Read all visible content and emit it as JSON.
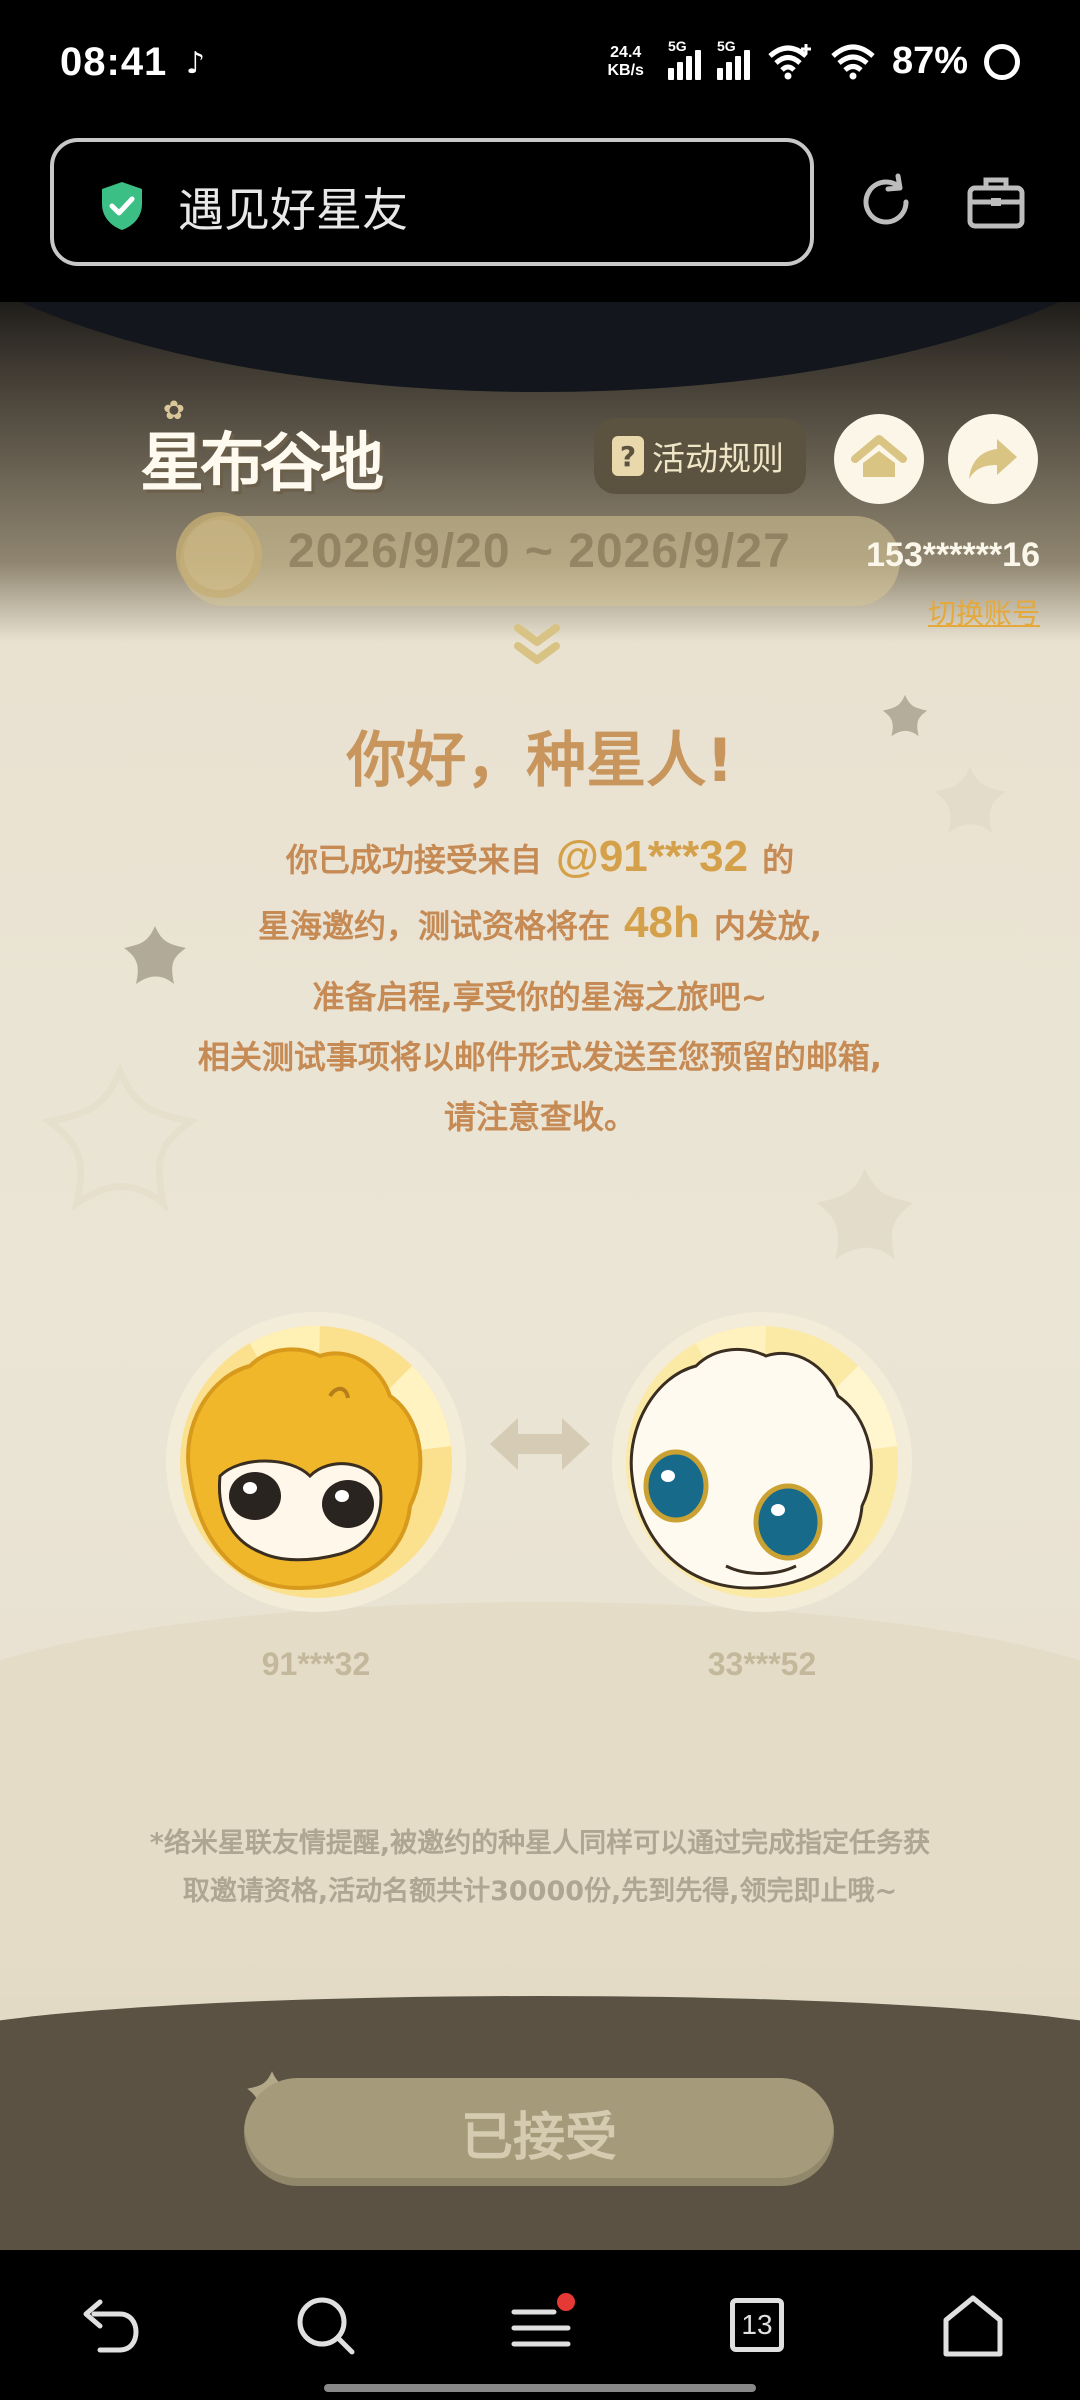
{
  "status_bar": {
    "time": "08:41",
    "notification_icon": "tiktok-icon",
    "net_speed_value": "24.4",
    "net_speed_unit": "KB/s",
    "sim1": "5G",
    "sim2": "5G",
    "battery": "87%"
  },
  "browser": {
    "url_title": "遇见好星友",
    "secure_icon": "shield-check-icon",
    "refresh_icon": "refresh-icon",
    "toolbox_icon": "briefcase-icon"
  },
  "page": {
    "logo": "星布谷地",
    "rules_label": "活动规则",
    "date_range": "2026/9/20 ~ 2026/9/27",
    "account": "153******16",
    "switch_account": "切换账号",
    "greeting": "你好，种星人!",
    "line1_pre": "你已成功接受来自",
    "inviter_handle": "@91***32",
    "line1_post": "的",
    "line2_pre": "星海邀约，测试资格将在",
    "hours": "48h",
    "line2_post": "内发放,",
    "line3": "准备启程,享受你的星海之旅吧~",
    "line4": "相关测试事项将以邮件形式发送至您预留的邮箱,",
    "line5": "请注意查收。",
    "inviter_id": "91***32",
    "invitee_id": "33***52",
    "note_line1": "*络米星联友情提醒,被邀约的种星人同样可以通过完成指定任务获",
    "note_line2": "取邀请资格,活动名额共计30000份,先到先得,领完即止哦~",
    "accept_button": "已接受"
  },
  "bottom_nav": {
    "tabs_count": "13",
    "menu_badge_color": "#e53935"
  },
  "colors": {
    "accent_gold": "#d4a14a",
    "text_brown": "#c68a54",
    "footer_brown": "#5b5244"
  }
}
